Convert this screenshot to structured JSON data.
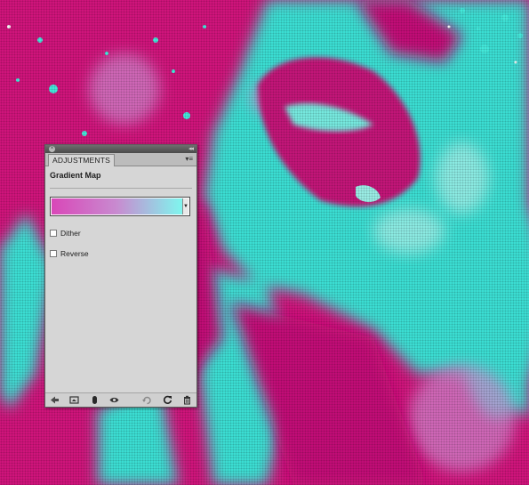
{
  "panel": {
    "tab_label": "ADJUSTMENTS",
    "menu_icon": "panel-menu-icon",
    "adjustment_title": "Gradient Map",
    "gradient": {
      "colors": [
        "#d947b8",
        "#c88bd0",
        "#7ff6ee"
      ]
    },
    "options": [
      {
        "label": "Dither",
        "checked": false
      },
      {
        "label": "Reverse",
        "checked": false
      }
    ],
    "bottom_icons": [
      "return-to-list-icon",
      "expanded-view-icon",
      "clip-to-layer-icon",
      "visibility-eye-icon",
      "view-previous-state-icon",
      "reset-icon",
      "delete-icon"
    ]
  },
  "background": {
    "palette": {
      "magenta": "#d6157f",
      "cyan": "#38e9d8"
    }
  }
}
